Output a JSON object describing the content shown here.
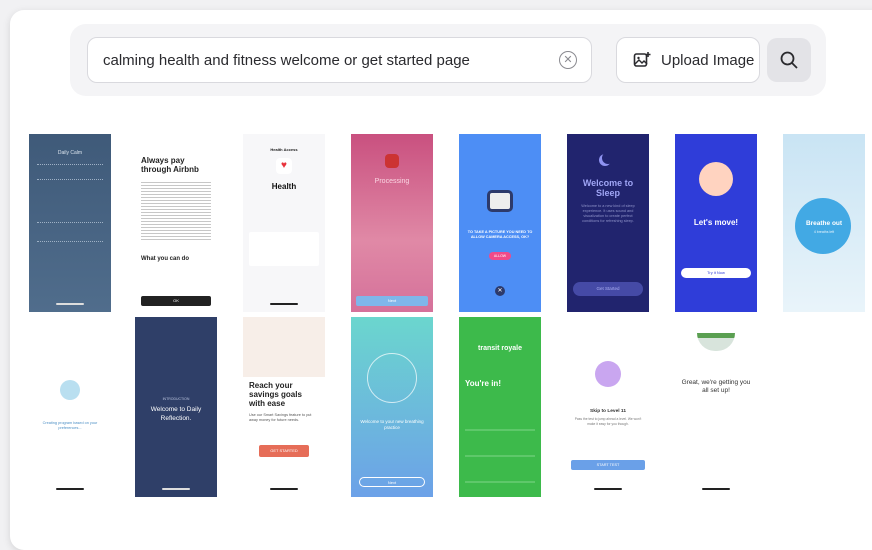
{
  "search": {
    "query": "calming health and fitness welcome or get started page",
    "clear_icon": "clear-circle-icon",
    "upload_label": "Upload Image",
    "upload_icon": "image-upload-icon",
    "search_icon": "magnifier-icon"
  },
  "thumbnails": [
    {
      "title": "Daily Calm"
    },
    {
      "title": "Always pay through Airbnb",
      "subtitle": "What you can do",
      "button": "OK"
    },
    {
      "title": "Health",
      "top": "Health Access",
      "subtitle": "\"Steps\" would like to access and update your Health data."
    },
    {
      "title": "Processing",
      "button": "Next"
    },
    {
      "title": "TO TAKE A PICTURE YOU NEED TO ALLOW CAMERA ACCESS, OK?",
      "button": "ALLOW"
    },
    {
      "title": "Welcome to Sleep",
      "subtitle": "Welcome to a new kind of sleep experience. It uses sound and visualization to create perfect conditions for refreshing sleep.",
      "button": "Get Started"
    },
    {
      "title": "Let's move!",
      "button": "Try it Now"
    },
    {
      "title": "Breathe out",
      "subtitle": "4 breaths left"
    },
    {
      "title": "Creating program based on your preferences..."
    },
    {
      "title": "Welcome to Daily Reflection.",
      "top": "INTRODUCTION"
    },
    {
      "title": "Reach your savings goals with ease",
      "subtitle": "Use our Smart Savings feature to put away money for future needs.",
      "button": "GET STARTED"
    },
    {
      "title": "Welcome to your new breathing practice",
      "button": "Next"
    },
    {
      "title": "You're in!",
      "top": "transit royale"
    },
    {
      "title": "Skip to Level 11",
      "subtitle": "Pass the test to jump ahead a level. We won't make it easy for you though.",
      "button": "START TEST"
    },
    {
      "title": "Great, we're getting you all set up!"
    }
  ]
}
